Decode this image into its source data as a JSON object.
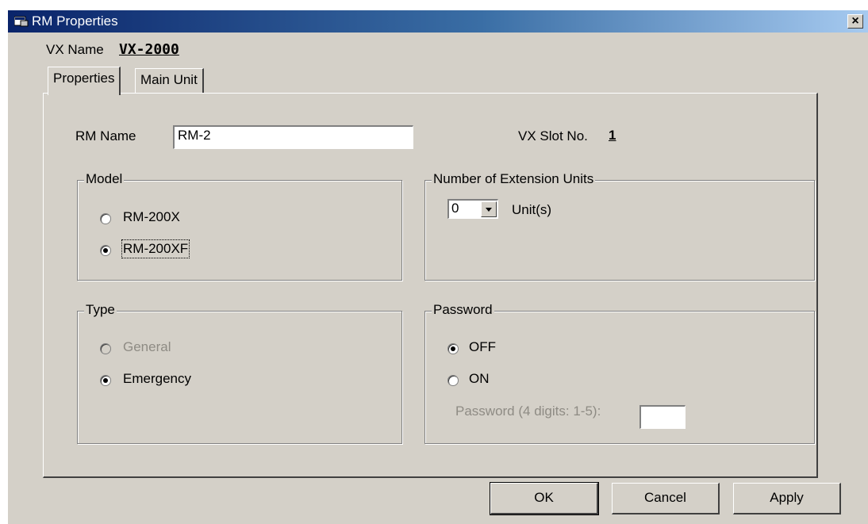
{
  "window": {
    "title": "RM Properties",
    "close_glyph": "×"
  },
  "header": {
    "vx_name_label": "VX Name",
    "vx_name_value": "VX-2000"
  },
  "tabs": [
    {
      "label": "Properties",
      "active": true
    },
    {
      "label": "Main Unit",
      "active": false
    }
  ],
  "properties": {
    "rm_name_label": "RM Name",
    "rm_name_value": "RM-2",
    "vx_slot_label": "VX Slot No.",
    "vx_slot_value": "1",
    "model": {
      "label": "Model",
      "options": [
        {
          "label": "RM-200X",
          "checked": false
        },
        {
          "label": "RM-200XF",
          "checked": true
        }
      ]
    },
    "extension": {
      "label": "Number of Extension Units",
      "value": "0",
      "unit": "Unit(s)"
    },
    "type": {
      "label": "Type",
      "options": [
        {
          "label": "General",
          "checked": false,
          "disabled": true
        },
        {
          "label": "Emergency",
          "checked": true
        }
      ]
    },
    "password": {
      "label": "Password",
      "options": [
        {
          "label": "OFF",
          "checked": true
        },
        {
          "label": "ON",
          "checked": false
        }
      ],
      "digits_label": "Password (4 digits: 1-5):",
      "digits_value": ""
    }
  },
  "buttons": {
    "ok": "OK",
    "cancel": "Cancel",
    "apply": "Apply"
  }
}
